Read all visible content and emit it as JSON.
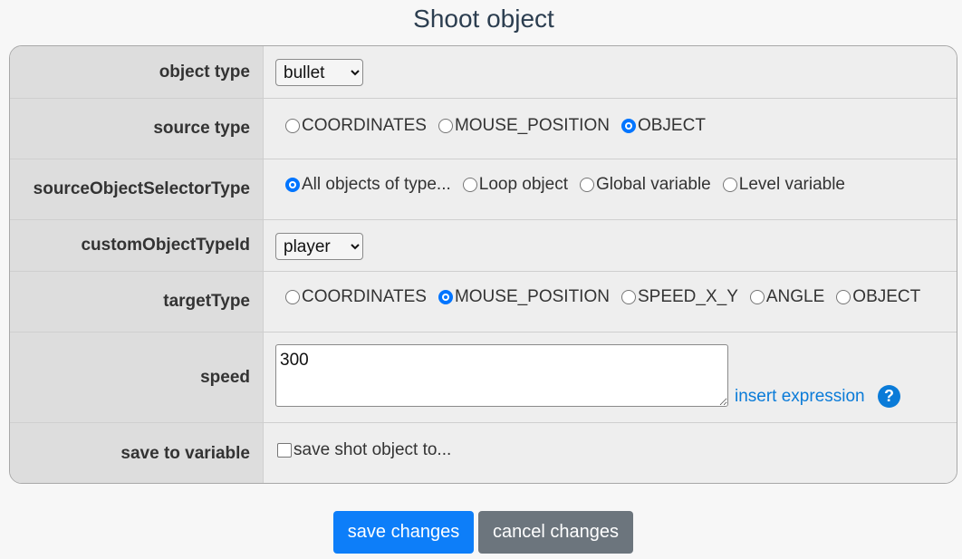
{
  "dialog": {
    "title": "Shoot object"
  },
  "fields": {
    "object_type": {
      "label": "object type",
      "value": "bullet",
      "options": [
        "bullet"
      ]
    },
    "source_type": {
      "label": "source type",
      "options": [
        "COORDINATES",
        "MOUSE_POSITION",
        "OBJECT"
      ],
      "selected": "OBJECT"
    },
    "source_selector": {
      "label": "sourceObjectSelectorType",
      "options": [
        "All objects of type...",
        "Loop object",
        "Global variable",
        "Level variable"
      ],
      "selected": "All objects of type..."
    },
    "custom_type": {
      "label": "customObjectTypeId",
      "value": "player",
      "options": [
        "player"
      ]
    },
    "target_type": {
      "label": "targetType",
      "options": [
        "COORDINATES",
        "MOUSE_POSITION",
        "SPEED_X_Y",
        "ANGLE",
        "OBJECT"
      ],
      "selected": "MOUSE_POSITION"
    },
    "speed": {
      "label": "speed",
      "value": "300",
      "insert_label": "insert expression",
      "help_glyph": "?"
    },
    "save_var": {
      "label": "save to variable",
      "checkbox_label": "save shot object to...",
      "checked": false
    }
  },
  "buttons": {
    "save": "save changes",
    "cancel": "cancel changes"
  },
  "colors": {
    "accent": "#0d7ef9",
    "secondary": "#6c757d",
    "link": "#0a7bd8"
  },
  "icons": {
    "help": "question-circle-icon",
    "resize": "resize-grip-icon"
  }
}
